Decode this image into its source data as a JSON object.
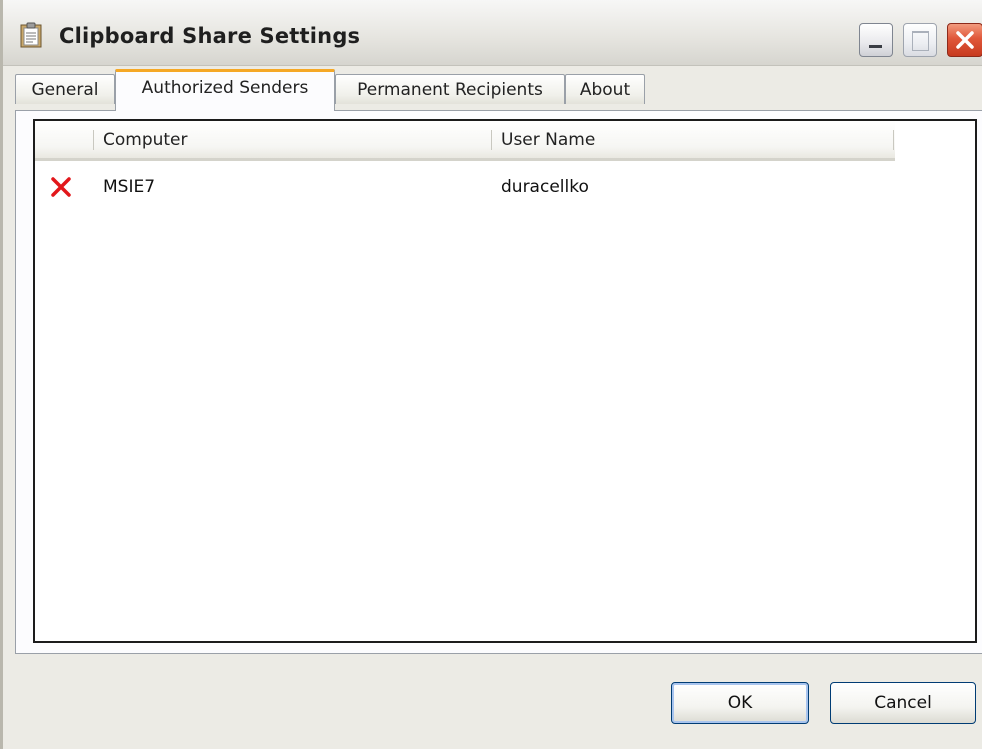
{
  "window": {
    "title": "Clipboard Share Settings",
    "icon": "clipboard-icon"
  },
  "tabs": [
    {
      "label": "General",
      "active": false
    },
    {
      "label": "Authorized Senders",
      "active": true
    },
    {
      "label": "Permanent Recipients",
      "active": false
    },
    {
      "label": "About",
      "active": false
    }
  ],
  "senders": {
    "columns": [
      "",
      "Computer",
      "User Name"
    ],
    "rows": [
      {
        "delete_icon": "red-x-delete-icon",
        "computer": "MSIE7",
        "user_name": "duracellko"
      }
    ]
  },
  "buttons": {
    "ok": "OK",
    "cancel": "Cancel"
  },
  "colors": {
    "active_tab_accent": "#f5a826",
    "delete_icon": "#e2171b",
    "close_button": "#e0573a"
  }
}
